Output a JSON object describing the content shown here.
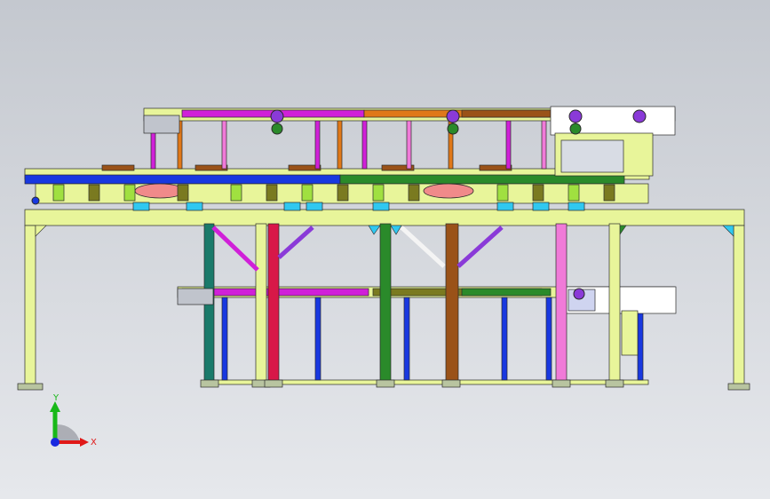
{
  "viewport": {
    "background_top": "#c4c8cf",
    "background_bottom": "#e6e8ec"
  },
  "model": {
    "frame_color": "#e8f59a",
    "frame_edge": "#2a2a2a",
    "colors": {
      "magenta": "#d020d8",
      "orange": "#e07818",
      "blue": "#1838e0",
      "teal": "#1a7a6a",
      "green": "#2a8a2a",
      "brown": "#9a5218",
      "pink": "#f07ad8",
      "salmon": "#f08a8a",
      "cyan": "#30c8f0",
      "olive": "#7a7a20",
      "red": "#d81848",
      "purple": "#8a3ad8",
      "lime": "#a0e040"
    }
  },
  "triad": {
    "y_label": "Y",
    "x_label": "X",
    "y_color": "#18b818",
    "x_color": "#e01818",
    "z_color": "#1828e0"
  }
}
